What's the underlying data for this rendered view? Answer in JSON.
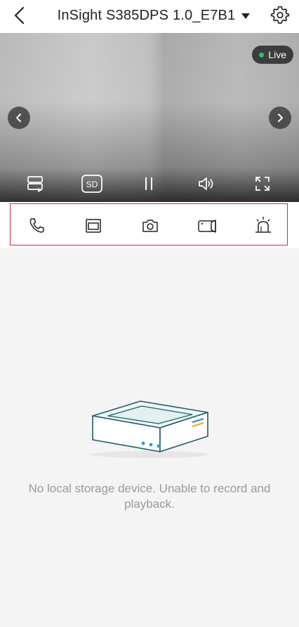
{
  "header": {
    "title": "InSight S385DPS 1.0_E7B1",
    "back_icon": "chevron-left-icon",
    "dropdown_icon": "caret-down-icon",
    "settings_icon": "gear-icon"
  },
  "video": {
    "live_label": "Live",
    "live_dot_color": "#29c46b",
    "controls": {
      "sd_label": "SD"
    }
  },
  "actions": {
    "highlight_color": "#d6262e",
    "items": [
      "phone-icon",
      "window-icon",
      "camera-icon",
      "video-record-icon",
      "alarm-light-icon"
    ]
  },
  "empty_state": {
    "message": "No local storage device. Unable to record and playback.",
    "illustration": "storage-device-illustration"
  }
}
